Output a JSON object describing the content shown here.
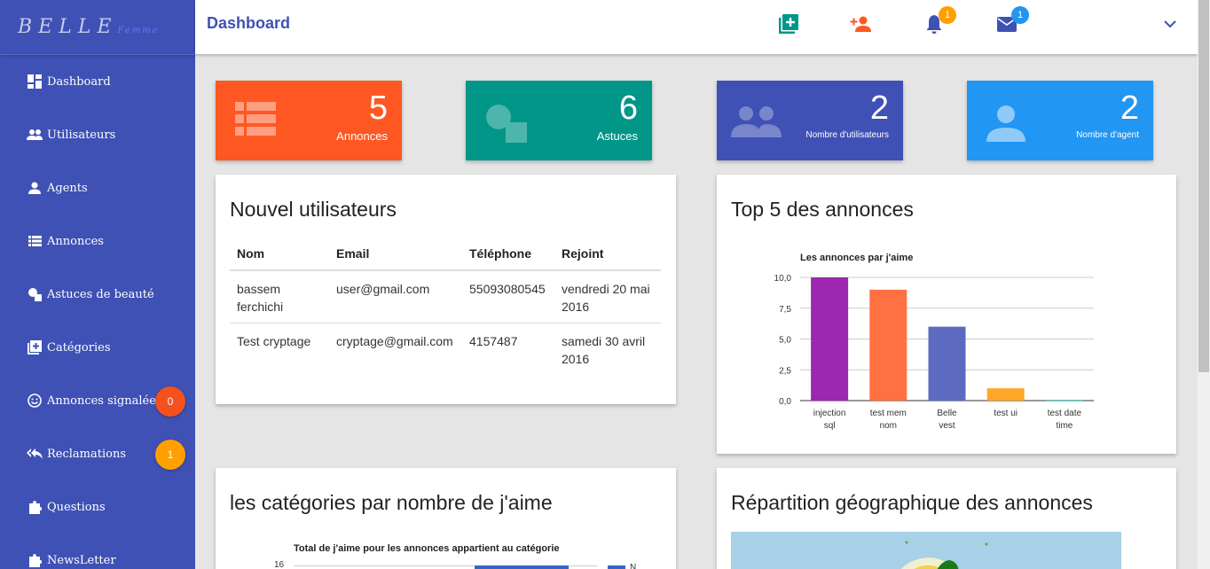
{
  "brand": {
    "main": "BELLE",
    "sub": "Femme"
  },
  "header": {
    "title": "Dashboard",
    "notification_count": "1",
    "message_count": "1"
  },
  "sidebar": {
    "items": [
      {
        "label": "Dashboard"
      },
      {
        "label": "Utilisateurs"
      },
      {
        "label": "Agents"
      },
      {
        "label": "Annonces"
      },
      {
        "label": "Astuces de beauté"
      },
      {
        "label": "Catégories"
      },
      {
        "label": "Annonces signalées",
        "badge": "0"
      },
      {
        "label": "Reclamations",
        "badge": "1"
      },
      {
        "label": "Questions"
      },
      {
        "label": "NewsLetter"
      }
    ]
  },
  "stats": [
    {
      "value": "5",
      "label": "Annonces",
      "color": "#ff5722"
    },
    {
      "value": "6",
      "label": "Astuces",
      "color": "#009688"
    },
    {
      "value": "2",
      "label": "Nombre d'utilisateurs",
      "color": "#3f51b5"
    },
    {
      "value": "2",
      "label": "Nombre d'agent",
      "color": "#2196f3"
    }
  ],
  "users_panel": {
    "title": "Nouvel utilisateurs",
    "columns": [
      "Nom",
      "Email",
      "Téléphone",
      "Rejoint"
    ],
    "rows": [
      [
        "bassem ferchichi",
        "user@gmail.com",
        "55093080545",
        "vendredi 20 mai 2016"
      ],
      [
        "Test cryptage",
        "cryptage@gmail.com",
        "4157487",
        "samedi 30 avril 2016"
      ]
    ]
  },
  "top5_panel": {
    "title": "Top 5 des annonces"
  },
  "categories_panel": {
    "title": "les catégories par nombre de j'aime"
  },
  "geo_panel": {
    "title": "Répartition géographique des annonces"
  },
  "chart_data": [
    {
      "type": "bar",
      "title": "Les annonces par j'aime",
      "categories": [
        "injection sql",
        "test mem nom",
        "Belle vest",
        "test ui",
        "test date time"
      ],
      "values": [
        10,
        9,
        6,
        1,
        0.05
      ],
      "colors": [
        "#9c27b0",
        "#ff7043",
        "#5c6bc0",
        "#ffa726",
        "#26a69a"
      ],
      "yticks": [
        "0,0",
        "2,5",
        "5,0",
        "7,5",
        "10,0"
      ],
      "ylim": [
        0,
        10
      ]
    },
    {
      "type": "bar",
      "title": "Total de j'aime pour les annonces appartient au catégorie",
      "yticks": [
        "16"
      ],
      "legend": [
        "N"
      ]
    }
  ]
}
